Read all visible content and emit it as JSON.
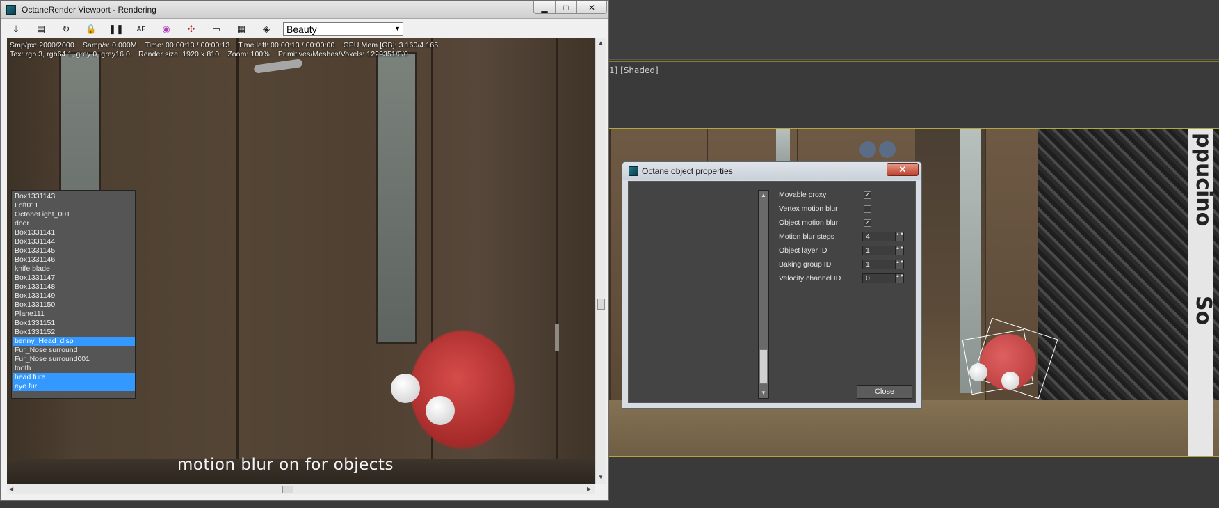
{
  "octane_window": {
    "title": "OctaneRender Viewport - Rendering",
    "controls": {
      "minimize": "▁",
      "maximize": "□",
      "close": "✕"
    },
    "toolbar": {
      "icons": [
        "save-render-icon",
        "copy-clipboard-icon",
        "restart-render-icon",
        "lock-icon",
        "pause-icon",
        "afr-icon",
        "color-wheel-icon",
        "region-icon",
        "viewport-icon",
        "film-settings-icon",
        "camera-icon"
      ],
      "glyphs": [
        "⇓",
        "▤",
        "↻",
        "🔒",
        "❚❚",
        "AF",
        "◉",
        "✣",
        "▭",
        "▦",
        "◈"
      ],
      "pass_selected": "Beauty",
      "pass_arrow": "▼"
    },
    "info_line1": "Smp/px: 2000/2000.   Samp/s: 0.000M.   Time: 00:00:13 / 00:00:13.   Time left: 00:00:13 / 00:00:00.   GPU Mem [GB]: 3.160/4.165",
    "info_line2": "Tex: rgb 3, rgb64 1, grey 0, grey16 0.   Render size: 1920 x 810.   Zoom: 100%.   Primitives/Meshes/Voxels: 1229351/0/0",
    "caption": "motion blur on for objects"
  },
  "viewport": {
    "label": "1] [Shaded]",
    "stripe_text": "ppucino",
    "stripe_text2": "So"
  },
  "props_dialog": {
    "title": "Octane object properties",
    "close_x": "✕",
    "objects": [
      {
        "name": "Box1331143",
        "selected": false
      },
      {
        "name": "Loft011",
        "selected": false
      },
      {
        "name": "OctaneLight_001",
        "selected": false
      },
      {
        "name": "door",
        "selected": false
      },
      {
        "name": "Box1331141",
        "selected": false
      },
      {
        "name": "Box1331144",
        "selected": false
      },
      {
        "name": "Box1331145",
        "selected": false
      },
      {
        "name": "Box1331146",
        "selected": false
      },
      {
        "name": "knife blade",
        "selected": false
      },
      {
        "name": "Box1331147",
        "selected": false
      },
      {
        "name": "Box1331148",
        "selected": false
      },
      {
        "name": "Box1331149",
        "selected": false
      },
      {
        "name": "Box1331150",
        "selected": false
      },
      {
        "name": "Plane111",
        "selected": false
      },
      {
        "name": "Box1331151",
        "selected": false
      },
      {
        "name": "Box1331152",
        "selected": false
      },
      {
        "name": "benny_Head_disp",
        "selected": true
      },
      {
        "name": "Fur_Nose surround",
        "selected": false
      },
      {
        "name": "Fur_Nose surround001",
        "selected": false
      },
      {
        "name": "tooth",
        "selected": false
      },
      {
        "name": "head fure",
        "selected": true
      },
      {
        "name": "eye fur",
        "selected": true
      }
    ],
    "properties": {
      "movable_proxy": {
        "label": "Movable proxy",
        "checked": true,
        "mark": "✓"
      },
      "vertex_motion_blur": {
        "label": "Vertex motion blur",
        "checked": false,
        "mark": ""
      },
      "object_motion_blur": {
        "label": "Object motion blur",
        "checked": true,
        "mark": "✓"
      },
      "motion_blur_steps": {
        "label": "Motion blur steps",
        "value": "4"
      },
      "object_layer_id": {
        "label": "Object layer ID",
        "value": "1"
      },
      "baking_group_id": {
        "label": "Baking group ID",
        "value": "1"
      },
      "velocity_channel_id": {
        "label": "Velocity channel ID",
        "value": "0"
      }
    },
    "close_button": "Close",
    "spinner_arrows": "▲▼",
    "scroll_up": "▲",
    "scroll_down": "▼"
  },
  "scrollbars": {
    "up": "▲",
    "down": "▼",
    "left": "◀",
    "right": "▶"
  },
  "colors": {
    "selection": "#3399ff",
    "viewport_border": "#b3a640",
    "dialog_bg": "#444444"
  }
}
